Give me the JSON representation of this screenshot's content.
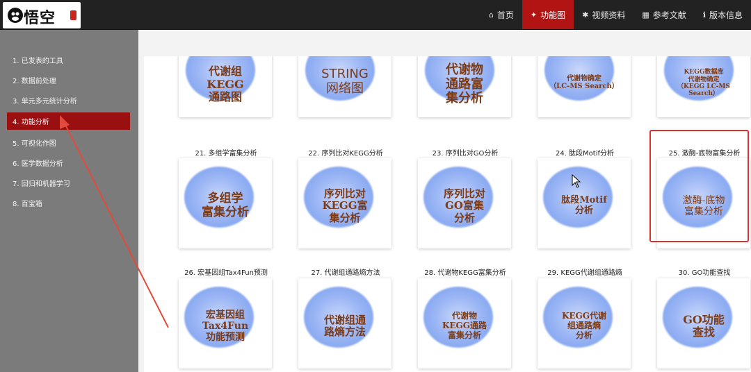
{
  "navbar": {
    "logo_text": "悟空",
    "items": [
      {
        "label": "首页",
        "icon": "home-icon",
        "glyph": "⌂"
      },
      {
        "label": "功能图",
        "icon": "function-icon",
        "glyph": "✦"
      },
      {
        "label": "视频资料",
        "icon": "video-icon",
        "glyph": "✱"
      },
      {
        "label": "参考文献",
        "icon": "table-icon",
        "glyph": "▦"
      },
      {
        "label": "版本信息",
        "icon": "info-icon",
        "glyph": "ℹ"
      }
    ],
    "active_color": "#b21313"
  },
  "sidebar": {
    "items": [
      {
        "label": "1. 已发表的工具"
      },
      {
        "label": "2. 数据前处理"
      },
      {
        "label": "3. 单元多元统计分析"
      },
      {
        "label": "4. 功能分析"
      },
      {
        "label": "5. 可视化作图"
      },
      {
        "label": "6. 医学数据分析"
      },
      {
        "label": "7. 回归和机器学习"
      },
      {
        "label": "8. 百宝箱"
      }
    ],
    "active_index": 3
  },
  "tiles": {
    "row1": [
      {
        "caption": "",
        "text": "代谢组\nKEGG\n通路图"
      },
      {
        "caption": "",
        "text": "STRING\n网络图"
      },
      {
        "caption": "",
        "text": "代谢物\n通路富\n集分析"
      },
      {
        "caption": "",
        "text": "代谢物确定\n（LC-MS Search）"
      },
      {
        "caption": "",
        "text": "KEGG数据库\n代谢物确定\n（KEGG LC-MS\nSearch）"
      }
    ],
    "row2": [
      {
        "caption": "21. 多组学富集分析",
        "text": "多组学\n富集分析"
      },
      {
        "caption": "22. 序列比对KEGG分析",
        "text": "序列比对\nKEGG富\n集分析"
      },
      {
        "caption": "23. 序列比对GO分析",
        "text": "序列比对\nGO富集\n分析"
      },
      {
        "caption": "24. 肽段Motif分析",
        "text": "肽段Motif\n分析"
      },
      {
        "caption": "25. 激酶-底物富集分析",
        "text": "激酶-底物\n富集分析"
      }
    ],
    "row3": [
      {
        "caption": "26. 宏基因组Tax4Fun预测",
        "text": "宏基因组\nTax4Fun\n功能预测"
      },
      {
        "caption": "27. 代谢组通路熵方法",
        "text": "代谢组通\n路熵方法"
      },
      {
        "caption": "28. 代谢物KEGG富集分析",
        "text": "代谢物\nKEGG通路\n富集分析"
      },
      {
        "caption": "29. KEGG代谢组通路熵",
        "text": "KEGG代谢\n组通路熵\n分析"
      },
      {
        "caption": "30. GO功能查找",
        "text": "GO功能\n查找"
      }
    ]
  },
  "colors": {
    "sidebar_bg": "#7b7b7b",
    "sidebar_active": "#9a0f0f",
    "tile_text": "#7b3b16",
    "highlight": "#d93030",
    "annotation_arrow": "#e24a3b"
  }
}
